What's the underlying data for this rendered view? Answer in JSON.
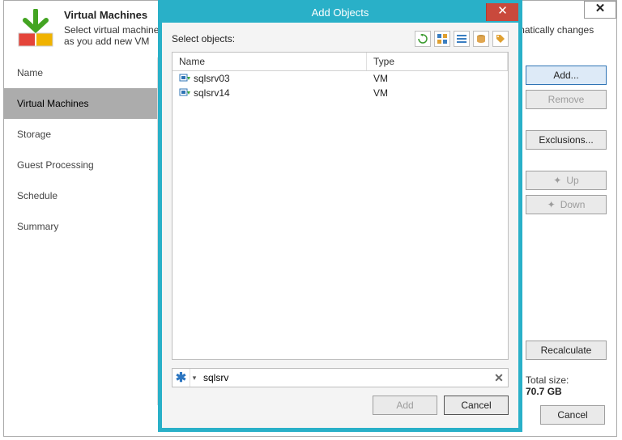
{
  "wizard": {
    "title": "Virtual Machines",
    "subtitle": "Select virtual machines to process                                                                                                          automatically changes\nas you add new VM",
    "table_header": "Name",
    "close_glyph": "✕",
    "nav": [
      "Name",
      "Virtual Machines",
      "Storage",
      "Guest Processing",
      "Schedule",
      "Summary"
    ],
    "nav_selected": 1,
    "buttons": {
      "add": "Add...",
      "remove": "Remove",
      "exclusions": "Exclusions...",
      "up": "Up",
      "down": "Down",
      "recalc": "Recalculate",
      "cancel": "Cancel"
    },
    "total_label": "Total size:",
    "total_value": "70.7 GB"
  },
  "modal": {
    "title": "Add Objects",
    "close_glyph": "✕",
    "select_label": "Select objects:",
    "view_icons": [
      "refresh-icon",
      "tree-icon",
      "list-icon",
      "datastore-icon",
      "tag-icon"
    ],
    "columns": {
      "name": "Name",
      "type": "Type"
    },
    "rows": [
      {
        "name": "sqlsrv03",
        "type": "VM"
      },
      {
        "name": "sqlsrv14",
        "type": "VM"
      }
    ],
    "search_value": "sqlsrv",
    "search_asterisk": "✱",
    "search_dropdown": "▾",
    "clear_glyph": "✕",
    "buttons": {
      "add": "Add",
      "cancel": "Cancel"
    }
  }
}
